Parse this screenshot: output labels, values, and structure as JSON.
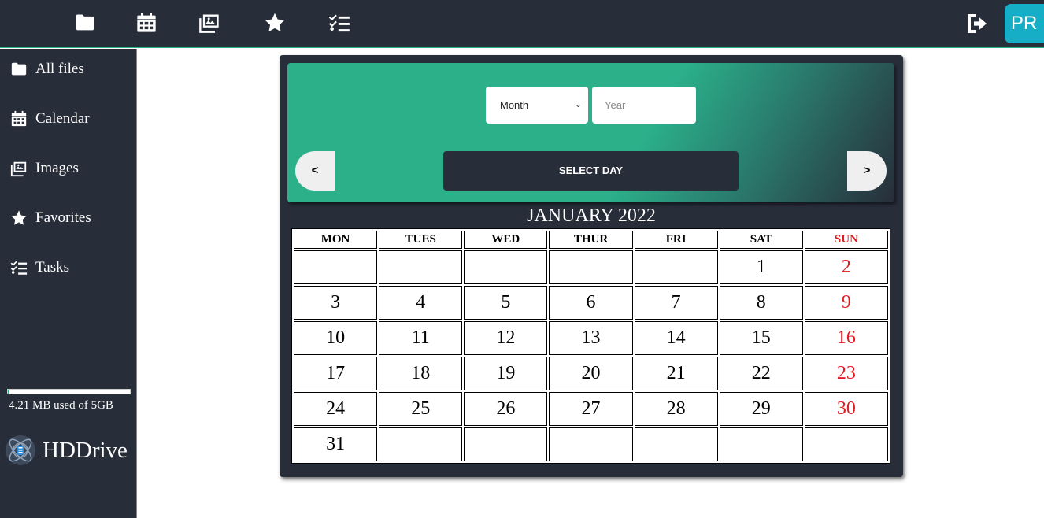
{
  "topbar": {
    "icons": [
      "folder-icon",
      "calendar-icon",
      "images-icon",
      "star-icon",
      "tasks-icon"
    ],
    "logout_icon": "logout-icon",
    "avatar_text": "PR"
  },
  "sidebar": {
    "items": [
      {
        "label": "All files",
        "icon": "folder-icon"
      },
      {
        "label": "Calendar",
        "icon": "calendar-icon"
      },
      {
        "label": "Images",
        "icon": "images-icon"
      },
      {
        "label": "Favorites",
        "icon": "star-icon"
      },
      {
        "label": "Tasks",
        "icon": "tasks-icon"
      }
    ],
    "storage_text": "4.21 MB used of 5GB",
    "storage_used_fraction": 0.0008,
    "brand": "HDDrive"
  },
  "calendar": {
    "month_placeholder": "Month",
    "year_placeholder": "Year",
    "prev_label": "<",
    "next_label": ">",
    "select_day_label": "SELECT DAY",
    "title": "JANUARY 2022",
    "weekdays": [
      "MON",
      "TUES",
      "WED",
      "THUR",
      "FRI",
      "SAT",
      "SUN"
    ],
    "weeks": [
      [
        "",
        "",
        "",
        "",
        "",
        "1",
        "2"
      ],
      [
        "3",
        "4",
        "5",
        "6",
        "7",
        "8",
        "9"
      ],
      [
        "10",
        "11",
        "12",
        "13",
        "14",
        "15",
        "16"
      ],
      [
        "17",
        "18",
        "19",
        "20",
        "21",
        "22",
        "23"
      ],
      [
        "24",
        "25",
        "26",
        "27",
        "28",
        "29",
        "30"
      ],
      [
        "31",
        "",
        "",
        "",
        "",
        "",
        ""
      ]
    ]
  },
  "colors": {
    "accent": "#2bb08a",
    "dark": "#282d3a",
    "sunday": "#e11b22",
    "avatar": "#15aec6"
  }
}
